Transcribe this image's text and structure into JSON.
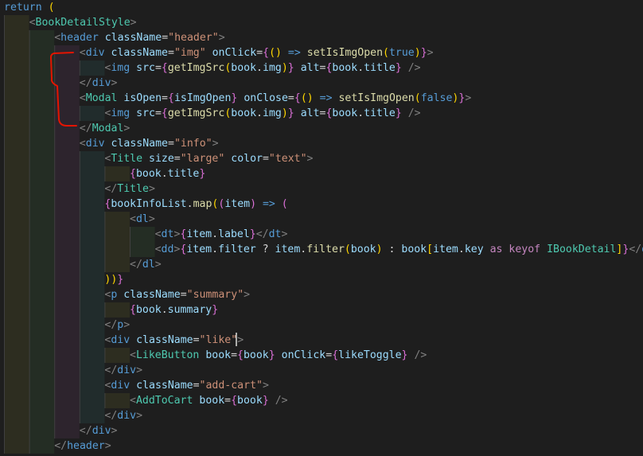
{
  "editor": {
    "lines": [
      [
        {
          "t": "return ",
          "c": "kw"
        },
        {
          "t": "(",
          "c": "paren"
        }
      ],
      [
        {
          "t": "<",
          "c": "brack"
        },
        {
          "t": "BookDetailStyle",
          "c": "comp"
        },
        {
          "t": ">",
          "c": "brack"
        }
      ],
      [
        {
          "t": "<",
          "c": "brack"
        },
        {
          "t": "header",
          "c": "tag"
        },
        {
          "t": " ",
          "c": "plain"
        },
        {
          "t": "className",
          "c": "attr"
        },
        {
          "t": "=",
          "c": "plain"
        },
        {
          "t": "\"header\"",
          "c": "str"
        },
        {
          "t": ">",
          "c": "brack"
        }
      ],
      [
        {
          "t": "<",
          "c": "brack"
        },
        {
          "t": "div",
          "c": "tag"
        },
        {
          "t": " ",
          "c": "plain"
        },
        {
          "t": "className",
          "c": "attr"
        },
        {
          "t": "=",
          "c": "plain"
        },
        {
          "t": "\"img\"",
          "c": "str"
        },
        {
          "t": " ",
          "c": "plain"
        },
        {
          "t": "onClick",
          "c": "attr"
        },
        {
          "t": "=",
          "c": "plain"
        },
        {
          "t": "{",
          "c": "brace"
        },
        {
          "t": "()",
          "c": "paren"
        },
        {
          "t": " => ",
          "c": "arrow"
        },
        {
          "t": "setIsImgOpen",
          "c": "fn"
        },
        {
          "t": "(",
          "c": "paren"
        },
        {
          "t": "true",
          "c": "kw"
        },
        {
          "t": ")",
          "c": "paren"
        },
        {
          "t": "}",
          "c": "brace"
        },
        {
          "t": ">",
          "c": "brack"
        }
      ],
      [
        {
          "t": "<",
          "c": "brack"
        },
        {
          "t": "img",
          "c": "tag"
        },
        {
          "t": " ",
          "c": "plain"
        },
        {
          "t": "src",
          "c": "attr"
        },
        {
          "t": "=",
          "c": "plain"
        },
        {
          "t": "{",
          "c": "brace"
        },
        {
          "t": "getImgSrc",
          "c": "fn"
        },
        {
          "t": "(",
          "c": "paren"
        },
        {
          "t": "book",
          "c": "var"
        },
        {
          "t": ".",
          "c": "plain"
        },
        {
          "t": "img",
          "c": "var"
        },
        {
          "t": ")",
          "c": "paren"
        },
        {
          "t": "}",
          "c": "brace"
        },
        {
          "t": " ",
          "c": "plain"
        },
        {
          "t": "alt",
          "c": "attr"
        },
        {
          "t": "=",
          "c": "plain"
        },
        {
          "t": "{",
          "c": "brace"
        },
        {
          "t": "book",
          "c": "var"
        },
        {
          "t": ".",
          "c": "plain"
        },
        {
          "t": "title",
          "c": "var"
        },
        {
          "t": "}",
          "c": "brace"
        },
        {
          "t": " />",
          "c": "brack"
        }
      ],
      [
        {
          "t": "</",
          "c": "brack"
        },
        {
          "t": "div",
          "c": "tag"
        },
        {
          "t": ">",
          "c": "brack"
        }
      ],
      [
        {
          "t": "<",
          "c": "brack"
        },
        {
          "t": "Modal",
          "c": "comp"
        },
        {
          "t": " ",
          "c": "plain"
        },
        {
          "t": "isOpen",
          "c": "attr"
        },
        {
          "t": "=",
          "c": "plain"
        },
        {
          "t": "{",
          "c": "brace"
        },
        {
          "t": "isImgOpen",
          "c": "var"
        },
        {
          "t": "}",
          "c": "brace"
        },
        {
          "t": " ",
          "c": "plain"
        },
        {
          "t": "onClose",
          "c": "attr"
        },
        {
          "t": "=",
          "c": "plain"
        },
        {
          "t": "{",
          "c": "brace"
        },
        {
          "t": "()",
          "c": "paren"
        },
        {
          "t": " => ",
          "c": "arrow"
        },
        {
          "t": "setIsImgOpen",
          "c": "fn"
        },
        {
          "t": "(",
          "c": "paren"
        },
        {
          "t": "false",
          "c": "kw"
        },
        {
          "t": ")",
          "c": "paren"
        },
        {
          "t": "}",
          "c": "brace"
        },
        {
          "t": ">",
          "c": "brack"
        }
      ],
      [
        {
          "t": "<",
          "c": "brack"
        },
        {
          "t": "img",
          "c": "tag"
        },
        {
          "t": " ",
          "c": "plain"
        },
        {
          "t": "src",
          "c": "attr"
        },
        {
          "t": "=",
          "c": "plain"
        },
        {
          "t": "{",
          "c": "brace"
        },
        {
          "t": "getImgSrc",
          "c": "fn"
        },
        {
          "t": "(",
          "c": "paren"
        },
        {
          "t": "book",
          "c": "var"
        },
        {
          "t": ".",
          "c": "plain"
        },
        {
          "t": "img",
          "c": "var"
        },
        {
          "t": ")",
          "c": "paren"
        },
        {
          "t": "}",
          "c": "brace"
        },
        {
          "t": " ",
          "c": "plain"
        },
        {
          "t": "alt",
          "c": "attr"
        },
        {
          "t": "=",
          "c": "plain"
        },
        {
          "t": "{",
          "c": "brace"
        },
        {
          "t": "book",
          "c": "var"
        },
        {
          "t": ".",
          "c": "plain"
        },
        {
          "t": "title",
          "c": "var"
        },
        {
          "t": "}",
          "c": "brace"
        },
        {
          "t": " />",
          "c": "brack"
        }
      ],
      [
        {
          "t": "</",
          "c": "brack"
        },
        {
          "t": "Modal",
          "c": "comp"
        },
        {
          "t": ">",
          "c": "brack"
        }
      ],
      [
        {
          "t": "<",
          "c": "brack"
        },
        {
          "t": "div",
          "c": "tag"
        },
        {
          "t": " ",
          "c": "plain"
        },
        {
          "t": "className",
          "c": "attr"
        },
        {
          "t": "=",
          "c": "plain"
        },
        {
          "t": "\"info\"",
          "c": "str"
        },
        {
          "t": ">",
          "c": "brack"
        }
      ],
      [
        {
          "t": "<",
          "c": "brack"
        },
        {
          "t": "Title",
          "c": "comp"
        },
        {
          "t": " ",
          "c": "plain"
        },
        {
          "t": "size",
          "c": "attr"
        },
        {
          "t": "=",
          "c": "plain"
        },
        {
          "t": "\"large\"",
          "c": "str"
        },
        {
          "t": " ",
          "c": "plain"
        },
        {
          "t": "color",
          "c": "attr"
        },
        {
          "t": "=",
          "c": "plain"
        },
        {
          "t": "\"text\"",
          "c": "str"
        },
        {
          "t": ">",
          "c": "brack"
        }
      ],
      [
        {
          "t": "{",
          "c": "brace"
        },
        {
          "t": "book",
          "c": "var"
        },
        {
          "t": ".",
          "c": "plain"
        },
        {
          "t": "title",
          "c": "var"
        },
        {
          "t": "}",
          "c": "brace"
        }
      ],
      [
        {
          "t": "</",
          "c": "brack"
        },
        {
          "t": "Title",
          "c": "comp"
        },
        {
          "t": ">",
          "c": "brack"
        }
      ],
      [
        {
          "t": "{",
          "c": "brace"
        },
        {
          "t": "bookInfoList",
          "c": "var"
        },
        {
          "t": ".",
          "c": "plain"
        },
        {
          "t": "map",
          "c": "fn"
        },
        {
          "t": "(",
          "c": "paren"
        },
        {
          "t": "(",
          "c": "brace"
        },
        {
          "t": "item",
          "c": "var"
        },
        {
          "t": ")",
          "c": "brace"
        },
        {
          "t": " => ",
          "c": "arrow"
        },
        {
          "t": "(",
          "c": "brace"
        }
      ],
      [
        {
          "t": "<",
          "c": "brack"
        },
        {
          "t": "dl",
          "c": "tag"
        },
        {
          "t": ">",
          "c": "brack"
        }
      ],
      [
        {
          "t": "<",
          "c": "brack"
        },
        {
          "t": "dt",
          "c": "tag"
        },
        {
          "t": ">",
          "c": "brack"
        },
        {
          "t": "{",
          "c": "brace"
        },
        {
          "t": "item",
          "c": "var"
        },
        {
          "t": ".",
          "c": "plain"
        },
        {
          "t": "label",
          "c": "var"
        },
        {
          "t": "}",
          "c": "brace"
        },
        {
          "t": "</",
          "c": "brack"
        },
        {
          "t": "dt",
          "c": "tag"
        },
        {
          "t": ">",
          "c": "brack"
        }
      ],
      [
        {
          "t": "<",
          "c": "brack"
        },
        {
          "t": "dd",
          "c": "tag"
        },
        {
          "t": ">",
          "c": "brack"
        },
        {
          "t": "{",
          "c": "brace"
        },
        {
          "t": "item",
          "c": "var"
        },
        {
          "t": ".",
          "c": "plain"
        },
        {
          "t": "filter",
          "c": "var"
        },
        {
          "t": " ? ",
          "c": "plain"
        },
        {
          "t": "item",
          "c": "var"
        },
        {
          "t": ".",
          "c": "plain"
        },
        {
          "t": "filter",
          "c": "fn"
        },
        {
          "t": "(",
          "c": "paren"
        },
        {
          "t": "book",
          "c": "var"
        },
        {
          "t": ")",
          "c": "paren"
        },
        {
          "t": " : ",
          "c": "plain"
        },
        {
          "t": "book",
          "c": "var"
        },
        {
          "t": "[",
          "c": "paren"
        },
        {
          "t": "item",
          "c": "var"
        },
        {
          "t": ".",
          "c": "plain"
        },
        {
          "t": "key",
          "c": "var"
        },
        {
          "t": " as ",
          "c": "kwb"
        },
        {
          "t": "keyof ",
          "c": "kwb"
        },
        {
          "t": "IBookDetail",
          "c": "type"
        },
        {
          "t": "]",
          "c": "paren"
        },
        {
          "t": "}",
          "c": "brace"
        },
        {
          "t": "</",
          "c": "brack"
        },
        {
          "t": "dd",
          "c": "tag"
        },
        {
          "t": ">",
          "c": "brack"
        }
      ],
      [
        {
          "t": "</",
          "c": "brack"
        },
        {
          "t": "dl",
          "c": "tag"
        },
        {
          "t": ">",
          "c": "brack"
        }
      ],
      [
        {
          "t": "))",
          "c": "paren"
        },
        {
          "t": "}",
          "c": "brace"
        }
      ],
      [
        {
          "t": "<",
          "c": "brack"
        },
        {
          "t": "p",
          "c": "tag"
        },
        {
          "t": " ",
          "c": "plain"
        },
        {
          "t": "className",
          "c": "attr"
        },
        {
          "t": "=",
          "c": "plain"
        },
        {
          "t": "\"summary\"",
          "c": "str"
        },
        {
          "t": ">",
          "c": "brack"
        }
      ],
      [
        {
          "t": "{",
          "c": "brace"
        },
        {
          "t": "book",
          "c": "var"
        },
        {
          "t": ".",
          "c": "plain"
        },
        {
          "t": "summary",
          "c": "var"
        },
        {
          "t": "}",
          "c": "brace"
        }
      ],
      [
        {
          "t": "</",
          "c": "brack"
        },
        {
          "t": "p",
          "c": "tag"
        },
        {
          "t": ">",
          "c": "brack"
        }
      ],
      [
        {
          "t": "<",
          "c": "brack"
        },
        {
          "t": "div",
          "c": "tag"
        },
        {
          "t": " ",
          "c": "plain"
        },
        {
          "t": "className",
          "c": "attr"
        },
        {
          "t": "=",
          "c": "plain"
        },
        {
          "t": "\"like\"",
          "c": "str"
        },
        {
          "t": ">",
          "c": "brack"
        }
      ],
      [
        {
          "t": "<",
          "c": "brack"
        },
        {
          "t": "LikeButton",
          "c": "comp"
        },
        {
          "t": " ",
          "c": "plain"
        },
        {
          "t": "book",
          "c": "attr"
        },
        {
          "t": "=",
          "c": "plain"
        },
        {
          "t": "{",
          "c": "brace"
        },
        {
          "t": "book",
          "c": "var"
        },
        {
          "t": "}",
          "c": "brace"
        },
        {
          "t": " ",
          "c": "plain"
        },
        {
          "t": "onClick",
          "c": "attr"
        },
        {
          "t": "=",
          "c": "plain"
        },
        {
          "t": "{",
          "c": "brace"
        },
        {
          "t": "likeToggle",
          "c": "var"
        },
        {
          "t": "}",
          "c": "brace"
        },
        {
          "t": " />",
          "c": "brack"
        }
      ],
      [
        {
          "t": "</",
          "c": "brack"
        },
        {
          "t": "div",
          "c": "tag"
        },
        {
          "t": ">",
          "c": "brack"
        }
      ],
      [
        {
          "t": "<",
          "c": "brack"
        },
        {
          "t": "div",
          "c": "tag"
        },
        {
          "t": " ",
          "c": "plain"
        },
        {
          "t": "className",
          "c": "attr"
        },
        {
          "t": "=",
          "c": "plain"
        },
        {
          "t": "\"add-cart\"",
          "c": "str"
        },
        {
          "t": ">",
          "c": "brack"
        }
      ],
      [
        {
          "t": "<",
          "c": "brack"
        },
        {
          "t": "AddToCart",
          "c": "comp"
        },
        {
          "t": " ",
          "c": "plain"
        },
        {
          "t": "book",
          "c": "attr"
        },
        {
          "t": "=",
          "c": "plain"
        },
        {
          "t": "{",
          "c": "brace"
        },
        {
          "t": "book",
          "c": "var"
        },
        {
          "t": "}",
          "c": "brace"
        },
        {
          "t": " />",
          "c": "brack"
        }
      ],
      [
        {
          "t": "</",
          "c": "brack"
        },
        {
          "t": "div",
          "c": "tag"
        },
        {
          "t": ">",
          "c": "brack"
        }
      ],
      [
        {
          "t": "</",
          "c": "brack"
        },
        {
          "t": "div",
          "c": "tag"
        },
        {
          "t": ">",
          "c": "brack"
        }
      ],
      [
        {
          "t": "</",
          "c": "brack"
        },
        {
          "t": "header",
          "c": "tag"
        },
        {
          "t": ">",
          "c": "brack"
        }
      ]
    ]
  },
  "colors": {
    "background": "#1e1e1e",
    "kw": "#569cd6",
    "kwb": "#c586c0",
    "paren": "#ffd700",
    "brace": "#da70d6",
    "brack": "#808080",
    "tag": "#569cd6",
    "comp": "#4ec9b0",
    "attr": "#9cdcfe",
    "str": "#ce9178",
    "var": "#9cdcfe",
    "fn": "#dcdcaa",
    "arrow": "#569cd6",
    "type": "#4ec9b0",
    "plain": "#d4d4d4",
    "annotation": "#e51400"
  }
}
